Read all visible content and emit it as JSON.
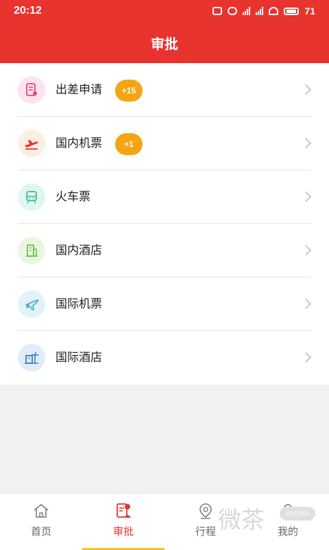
{
  "status_bar": {
    "time": "20:12",
    "battery": "71"
  },
  "header": {
    "title": "审批"
  },
  "list": [
    {
      "label": "出差申请",
      "badge": "+15",
      "icon": "document-icon",
      "icon_bg": "#fde3ee",
      "icon_color": "#e0447a"
    },
    {
      "label": "国内机票",
      "badge": "+1",
      "icon": "plane-takeoff-icon",
      "icon_bg": "#fdeee3",
      "icon_color": "#e23b2e"
    },
    {
      "label": "火车票",
      "badge": "",
      "icon": "train-icon",
      "icon_bg": "#e2f6f0",
      "icon_color": "#3bbf9a"
    },
    {
      "label": "国内酒店",
      "badge": "",
      "icon": "building-icon",
      "icon_bg": "#ebf6e2",
      "icon_color": "#6cc04a"
    },
    {
      "label": "国际机票",
      "badge": "",
      "icon": "airplane-icon",
      "icon_bg": "#e1f3f8",
      "icon_color": "#3aa6c8"
    },
    {
      "label": "国际酒店",
      "badge": "",
      "icon": "hotel-palm-icon",
      "icon_bg": "#e0ecf8",
      "icon_color": "#3e7fc4"
    }
  ],
  "tabs": [
    {
      "label": "首页",
      "icon": "home-icon",
      "active": false
    },
    {
      "label": "审批",
      "icon": "approval-icon",
      "active": true
    },
    {
      "label": "行程",
      "icon": "location-pin-icon",
      "active": false
    },
    {
      "label": "我的",
      "icon": "user-icon",
      "active": false
    }
  ],
  "watermark": {
    "text": "微茶",
    "sub": "WXCHA"
  },
  "colors": {
    "accent": "#e8332e",
    "badge": "#f5a514",
    "tab_indicator": "#f5c518"
  }
}
